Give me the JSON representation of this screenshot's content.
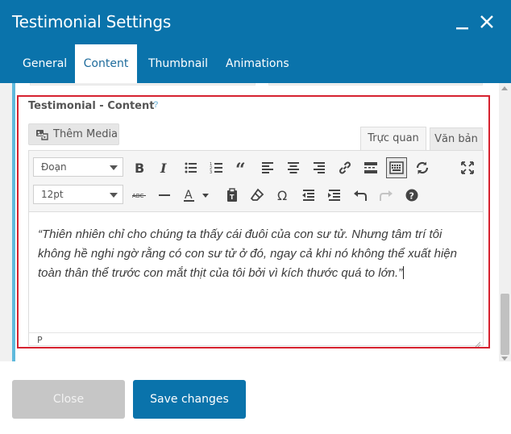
{
  "header": {
    "title": "Testimonial Settings",
    "color": "#0a73ab",
    "minimize_icon": "minimize-icon",
    "close_icon": "close-icon"
  },
  "tabs": [
    {
      "label": "General",
      "active": false
    },
    {
      "label": "Content",
      "active": true
    },
    {
      "label": "Thumbnail",
      "active": false
    },
    {
      "label": "Animations",
      "active": false
    }
  ],
  "section": {
    "label": "Testimonial - Content",
    "help": "?"
  },
  "media_button": {
    "label": "Thêm Media",
    "icon": "media-icon"
  },
  "editor_tabs": {
    "visual": "Trực quan",
    "text": "Văn bản"
  },
  "toolbar": {
    "format_select": "Đoạn",
    "font_size_select": "12pt",
    "row1_icons": [
      "bold-icon",
      "italic-icon",
      "bullet-list-icon",
      "numbered-list-icon",
      "blockquote-icon",
      "align-left-icon",
      "align-center-icon",
      "align-right-icon",
      "link-icon",
      "read-more-icon",
      "toolbar-toggle-icon",
      "refresh-icon",
      "fullscreen-icon"
    ],
    "row2_icons": [
      "strikethrough-icon",
      "horizontal-line-icon",
      "text-color-icon",
      "paste-text-icon",
      "clear-format-icon",
      "omega-icon",
      "outdent-icon",
      "indent-icon",
      "undo-icon",
      "redo-icon",
      "help-icon"
    ]
  },
  "editor": {
    "content": "“Thiên nhiên chỉ cho chúng ta thấy cái đuôi của con sư tử. Nhưng tâm trí tôi không hề nghi ngờ rằng có con sư tử ở đó, ngay cả khi nó không thể xuất hiện toàn thân thể trước con mắt thịt của tôi bởi vì kích thước quá to lớn.”",
    "path": "P"
  },
  "footer": {
    "close_label": "Close",
    "save_label": "Save changes"
  },
  "colors": {
    "accent": "#0a73ab",
    "highlight_border": "#d6222f",
    "panel_accent": "#5fb9dc"
  }
}
